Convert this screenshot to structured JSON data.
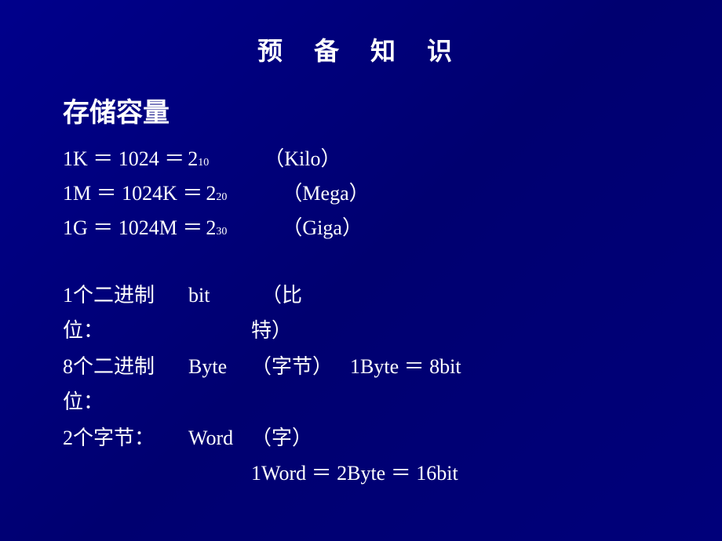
{
  "title": "预  备  知  识",
  "section": {
    "heading": "存储容量",
    "formulas": [
      {
        "prefix": "1K  ＝ 1024    ＝ ",
        "base": "2",
        "exp": "10",
        "note": "（Kilo）"
      },
      {
        "prefix": "1M ＝ 1024K  ＝ ",
        "base": "2",
        "exp": "20",
        "note": "（Mega）"
      },
      {
        "prefix": "1G  ＝ 1024M ＝ ",
        "base": "2",
        "exp": "30",
        "note": "（Giga）"
      }
    ]
  },
  "bits": {
    "lines": [
      {
        "label": "1个二进制位：",
        "term": "bit",
        "desc": "（比特）",
        "extra": ""
      },
      {
        "label": "8个二进制位：",
        "term": "Byte",
        "desc": "（字节）",
        "extra": "1Byte ＝ 8bit"
      },
      {
        "label": "2个字节：",
        "term": "Word",
        "desc": "（字）",
        "extra": ""
      }
    ],
    "word_formula": "1Word ＝ 2Byte ＝ 16bit"
  }
}
